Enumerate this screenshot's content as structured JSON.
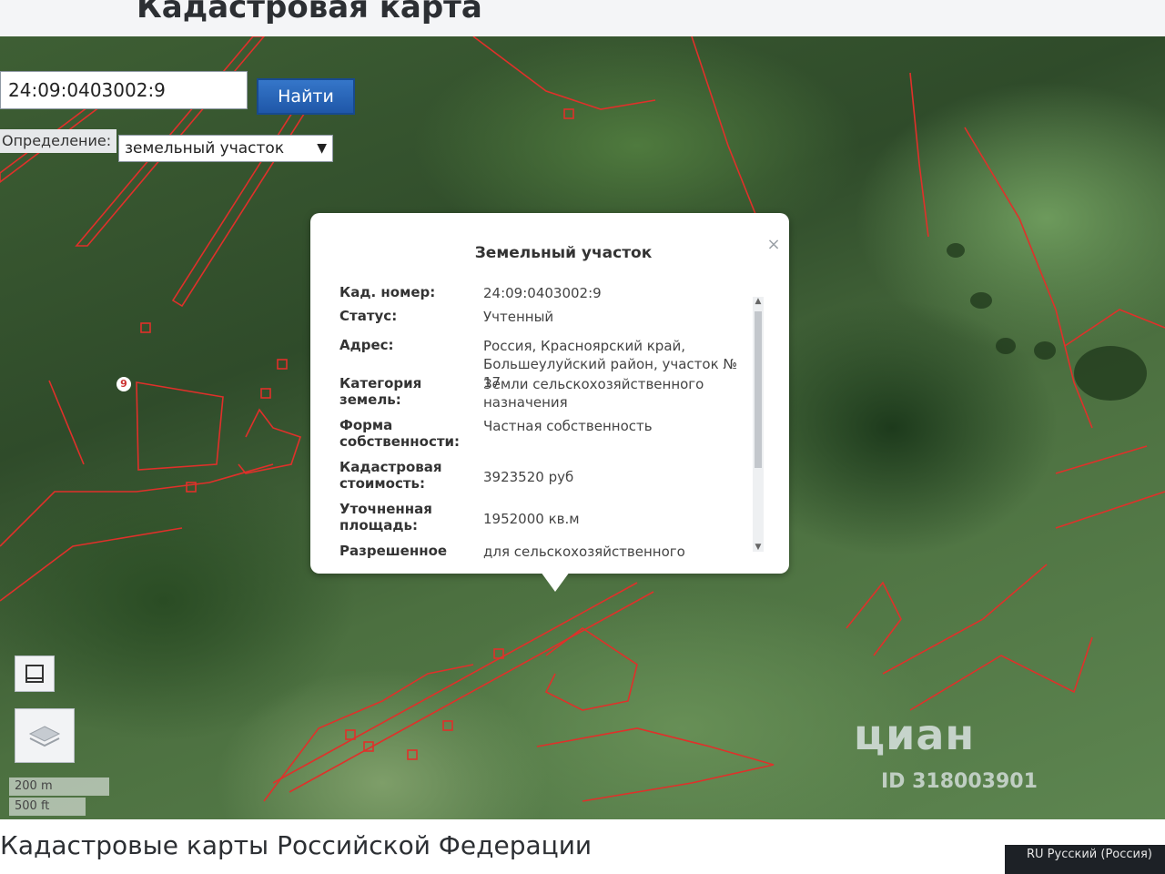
{
  "page": {
    "title": "Кадастровая карта",
    "footer_title": "Кадастровые карты Российской Федерации"
  },
  "search": {
    "value": "24:09:0403002:9",
    "button_label": "Найти"
  },
  "definition": {
    "label": "Определение:",
    "selected": "земельный участок"
  },
  "popup": {
    "title": "Земельный участок",
    "rows": [
      {
        "key": "Кад. номер:",
        "value": "24:09:0403002:9"
      },
      {
        "key": "Статус:",
        "value": "Учтенный"
      },
      {
        "key": "Адрес:",
        "value": "Россия, Красноярский край, Большеулуйский район, участок № 17"
      },
      {
        "key": "Категория земель:",
        "value": "Земли сельскохозяйственного назначения"
      },
      {
        "key": "Форма собственности:",
        "value": "Частная собственность"
      },
      {
        "key": "Кадастровая стоимость:",
        "value": "3923520 руб"
      },
      {
        "key": "Уточненная площадь:",
        "value": "1952000 кв.м"
      },
      {
        "key": "Разрешенное",
        "value": "для сельскохозяйственного"
      }
    ]
  },
  "map": {
    "marker_label": "9",
    "scale": {
      "metric": "200 m",
      "imperial": "500 ft"
    },
    "watermark": {
      "logo": "циан",
      "id": "ID 318003901"
    }
  },
  "taskbar": {
    "language": "RU Русский (Россия)"
  },
  "colors": {
    "accent": "#1f57a8",
    "parcel_lines": "#e0302a"
  }
}
